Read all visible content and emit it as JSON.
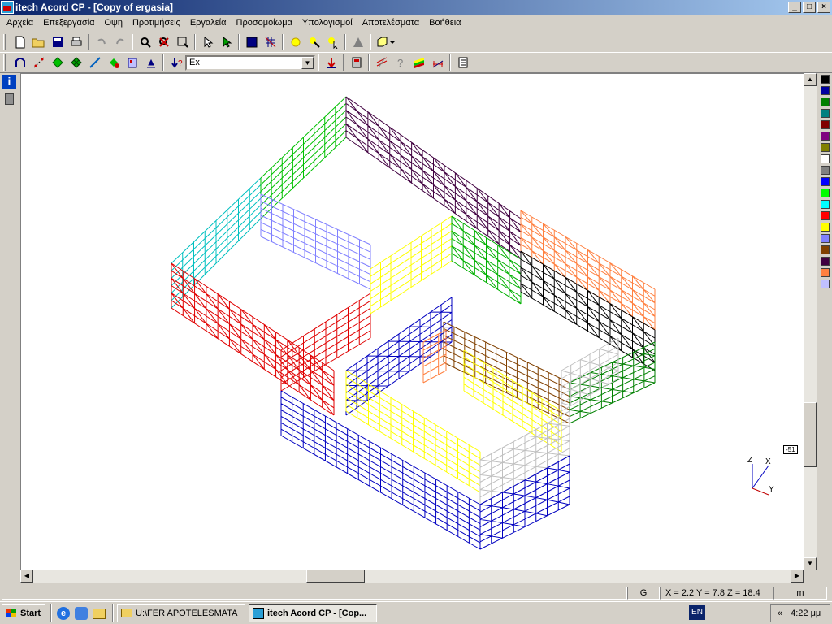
{
  "window": {
    "title": "itech Acord CP - [Copy of ergasia]"
  },
  "menu": [
    "Αρχεία",
    "Επεξεργασία",
    "Οψη",
    "Προτιμήσεις",
    "Εργαλεία",
    "Προσομοίωμα",
    "Υπολογισμοί",
    "Αποτελέσματα",
    "Βοήθεια"
  ],
  "toolbar2": {
    "combo_value": "Ex"
  },
  "canvas": {
    "axes": {
      "z": "Z",
      "x": "X",
      "y": "Y"
    },
    "scale_tag": "-51"
  },
  "palette": [
    "#000000",
    "#0000a0",
    "#008000",
    "#008080",
    "#800000",
    "#800080",
    "#808000",
    "#ffffff",
    "#808080",
    "#0000ff",
    "#00ff00",
    "#00ffff",
    "#ff0000",
    "#ffff00",
    "#8080ff",
    "#804000",
    "#400040",
    "#ff8040",
    "#c0c0ff"
  ],
  "status": {
    "mode": "G",
    "coords": "X = 2.2  Y = 7.8  Z = 18.4",
    "unit": "m"
  },
  "taskbar": {
    "start": "Start",
    "tasks": [
      "U:\\FER APOTELESMATA",
      "itech Acord CP - [Cop..."
    ],
    "lang": "EN",
    "clock": "4:22 μμ"
  }
}
